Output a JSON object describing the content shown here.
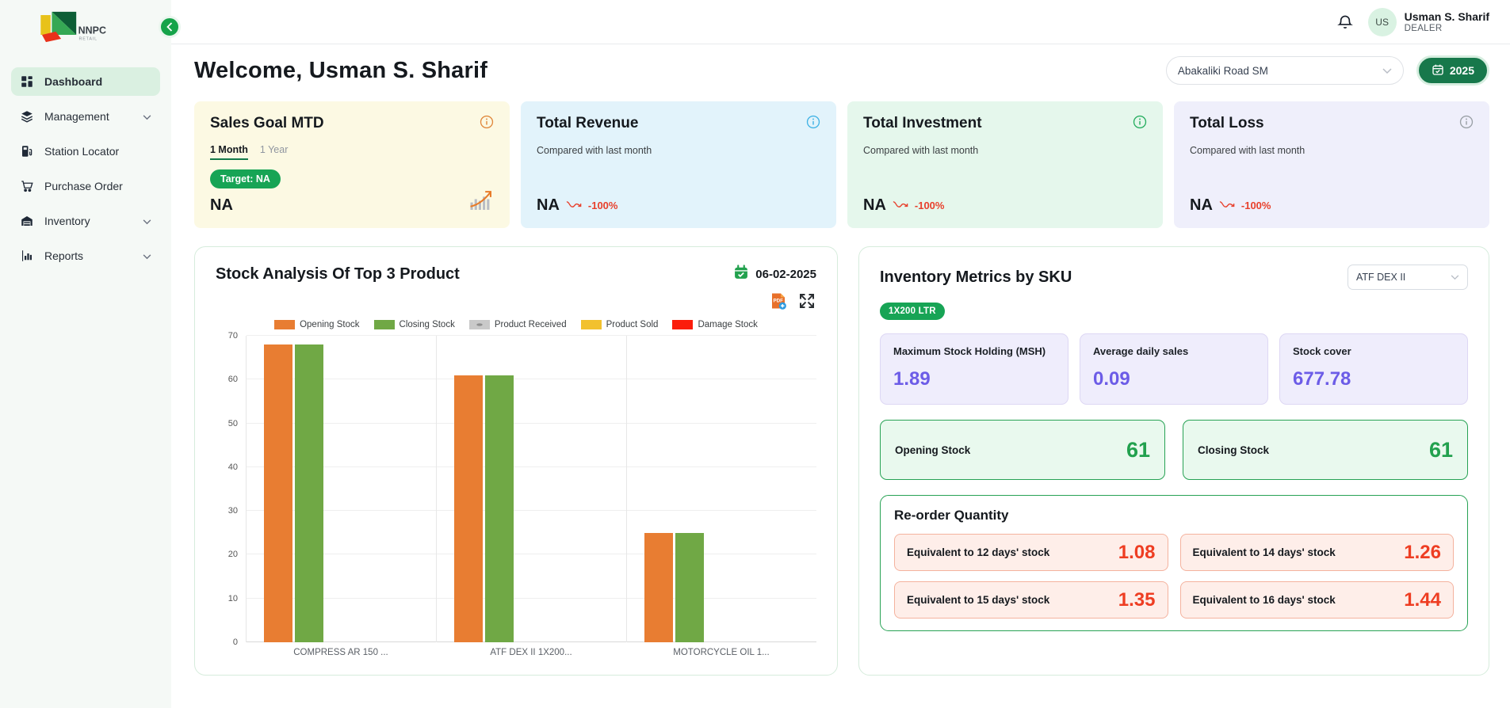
{
  "sidebar": {
    "brand": "NNPC",
    "brand_sub": "RETAIL",
    "items": [
      {
        "label": "Dashboard",
        "icon": "grid-icon",
        "active": true,
        "chevron": false
      },
      {
        "label": "Management",
        "icon": "layers-icon",
        "active": false,
        "chevron": true
      },
      {
        "label": "Station Locator",
        "icon": "fuel-pump-icon",
        "active": false,
        "chevron": false
      },
      {
        "label": "Purchase Order",
        "icon": "cart-icon",
        "active": false,
        "chevron": false
      },
      {
        "label": "Inventory",
        "icon": "garage-icon",
        "active": false,
        "chevron": true
      },
      {
        "label": "Reports",
        "icon": "bar-chart-icon",
        "active": false,
        "chevron": true
      }
    ]
  },
  "topbar": {
    "user_name": "Usman S. Sharif",
    "user_role": "DEALER",
    "avatar_initials": "US"
  },
  "header": {
    "welcome": "Welcome, Usman S. Sharif",
    "station_select_value": "Abakaliki Road SM",
    "year_button": "2025"
  },
  "sales_goal": {
    "title": "Sales Goal MTD",
    "tab_month": "1 Month",
    "tab_year": "1 Year",
    "target_label": "Target: NA",
    "value": "NA"
  },
  "kpi_cards": [
    {
      "title": "Total Revenue",
      "compare": "Compared with last month",
      "value": "NA",
      "delta": "-100%"
    },
    {
      "title": "Total Investment",
      "compare": "Compared with last month",
      "value": "NA",
      "delta": "-100%"
    },
    {
      "title": "Total Loss",
      "compare": "Compared with last month",
      "value": "NA",
      "delta": "-100%"
    }
  ],
  "stock_panel": {
    "title": "Stock Analysis Of Top 3 Product",
    "date": "06-02-2025"
  },
  "chart_data": {
    "type": "bar",
    "title": "Stock Analysis Of Top 3 Product",
    "categories": [
      "COMPRESS AR 150 ...",
      "ATF DEX II 1X200...",
      "MOTORCYCLE OIL 1..."
    ],
    "series": [
      {
        "name": "Opening Stock",
        "color": "#e87d32",
        "pattern": "solid",
        "values": [
          68,
          61,
          25
        ]
      },
      {
        "name": "Closing Stock",
        "color": "#70a845",
        "pattern": "solid",
        "values": [
          68,
          61,
          25
        ]
      },
      {
        "name": "Product Received",
        "color": "#c9c9c9",
        "pattern": "dotted",
        "values": [
          0,
          0,
          0
        ]
      },
      {
        "name": "Product Sold",
        "color": "#f2c12e",
        "pattern": "solid",
        "values": [
          0,
          0,
          0
        ]
      },
      {
        "name": "Damage Stock",
        "color": "#fb1d0c",
        "pattern": "solid",
        "values": [
          0,
          0,
          0
        ]
      }
    ],
    "xlabel": "",
    "ylabel": "",
    "ylim": [
      0,
      70
    ],
    "ytick_step": 10,
    "grid": true,
    "legend_position": "top"
  },
  "inventory": {
    "title": "Inventory Metrics by SKU",
    "sku_select_value": "ATF DEX II",
    "sku_badge": "1X200 LTR",
    "metrics": [
      {
        "label": "Maximum Stock Holding (MSH)",
        "value": "1.89"
      },
      {
        "label": "Average daily sales",
        "value": "0.09"
      },
      {
        "label": "Stock cover",
        "value": "677.78"
      }
    ],
    "stocks": [
      {
        "label": "Opening Stock",
        "value": "61"
      },
      {
        "label": "Closing Stock",
        "value": "61"
      }
    ],
    "reorder": {
      "title": "Re-order Quantity",
      "items": [
        {
          "label": "Equivalent to 12 days' stock",
          "value": "1.08"
        },
        {
          "label": "Equivalent to 14 days' stock",
          "value": "1.26"
        },
        {
          "label": "Equivalent to 15 days' stock",
          "value": "1.35"
        },
        {
          "label": "Equivalent to 16 days' stock",
          "value": "1.44"
        }
      ]
    }
  },
  "colors": {
    "primary_green": "#16a34a",
    "dark_green_button": "#17784b",
    "active_item_bg": "#daf0e1",
    "kpi_yellow_bg": "#fcf9e3",
    "kpi_blue_bg": "#e2f3fb",
    "kpi_green_bg": "#e5f7ec",
    "kpi_lavender_bg": "#efeffb",
    "negative_red": "#e8402c",
    "metric_purple": "#6c5ce7",
    "stock_green": "#22a14e",
    "reorder_red": "#ee3d22"
  }
}
